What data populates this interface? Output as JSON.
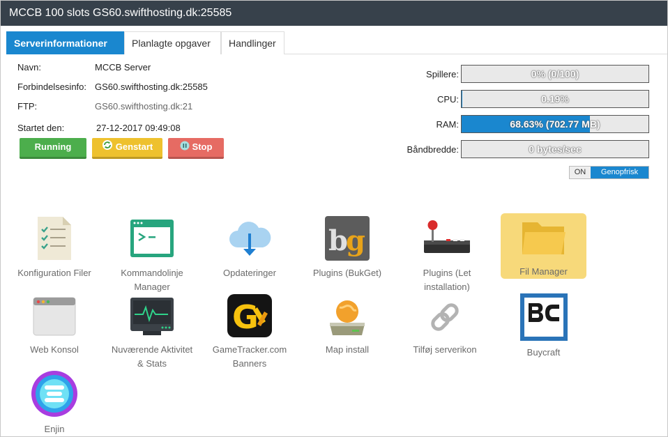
{
  "window": {
    "title": "MCCB 100 slots GS60.swifthosting.dk:25585"
  },
  "tabs": [
    {
      "label": "Serverinformationer"
    },
    {
      "label": "Planlagte opgaver"
    },
    {
      "label": "Handlinger"
    }
  ],
  "info": {
    "name_label": "Navn:",
    "name_value": "MCCB Server",
    "conn_label": "Forbindelsesinfo:",
    "conn_value": "GS60.swifthosting.dk:25585",
    "ftp_label": "FTP:",
    "ftp_value": "GS60.swifthosting.dk:21",
    "started_label": "Startet den:",
    "started_value": "27-12-2017 09:49:08"
  },
  "buttons": {
    "running": "Running",
    "restart": "Genstart",
    "stop": "Stop"
  },
  "stats": {
    "players_label": "Spillere:",
    "players_text": "0% (0/100)",
    "players_fraction": 0,
    "cpu_label": "CPU:",
    "cpu_text": "0.19%",
    "cpu_fraction": 0.0019,
    "ram_label": "RAM:",
    "ram_text": "68.63% (702.77 MB)",
    "ram_fraction": 0.6863,
    "bw_label": "Båndbredde:",
    "bw_text": "0 bytes/sec",
    "bw_fraction": 0
  },
  "refresh": {
    "on_label": "ON",
    "button_label": "Genopfrisk"
  },
  "tools": [
    {
      "label": "Konfiguration Filer",
      "icon": "checklist-document-icon"
    },
    {
      "label": "Kommandolinje Manager",
      "icon": "terminal-icon"
    },
    {
      "label": "Opdateringer",
      "icon": "cloud-download-icon"
    },
    {
      "label": "Plugins (BukGet)",
      "icon": "bukget-logo-icon"
    },
    {
      "label": "Plugins (Let installation)",
      "icon": "joystick-icon"
    },
    {
      "label": "Fil Manager",
      "icon": "folder-icon"
    },
    {
      "label": "Web Konsol",
      "icon": "browser-window-icon"
    },
    {
      "label": "Nuværende Aktivitet & Stats",
      "icon": "monitor-activity-icon"
    },
    {
      "label": "GameTracker.com Banners",
      "icon": "gametracker-logo-icon"
    },
    {
      "label": "Map install",
      "icon": "globe-drive-icon"
    },
    {
      "label": "Tilføj serverikon",
      "icon": "link-icon"
    },
    {
      "label": "Buycraft",
      "icon": "buycraft-logo-icon"
    },
    {
      "label": "Enjin",
      "icon": "enjin-logo-icon"
    }
  ],
  "colors": {
    "accent": "#1a87cf",
    "running": "#4cae4c",
    "restart": "#eec12e",
    "stop": "#e66b63",
    "highlight": "#f7d97a"
  }
}
